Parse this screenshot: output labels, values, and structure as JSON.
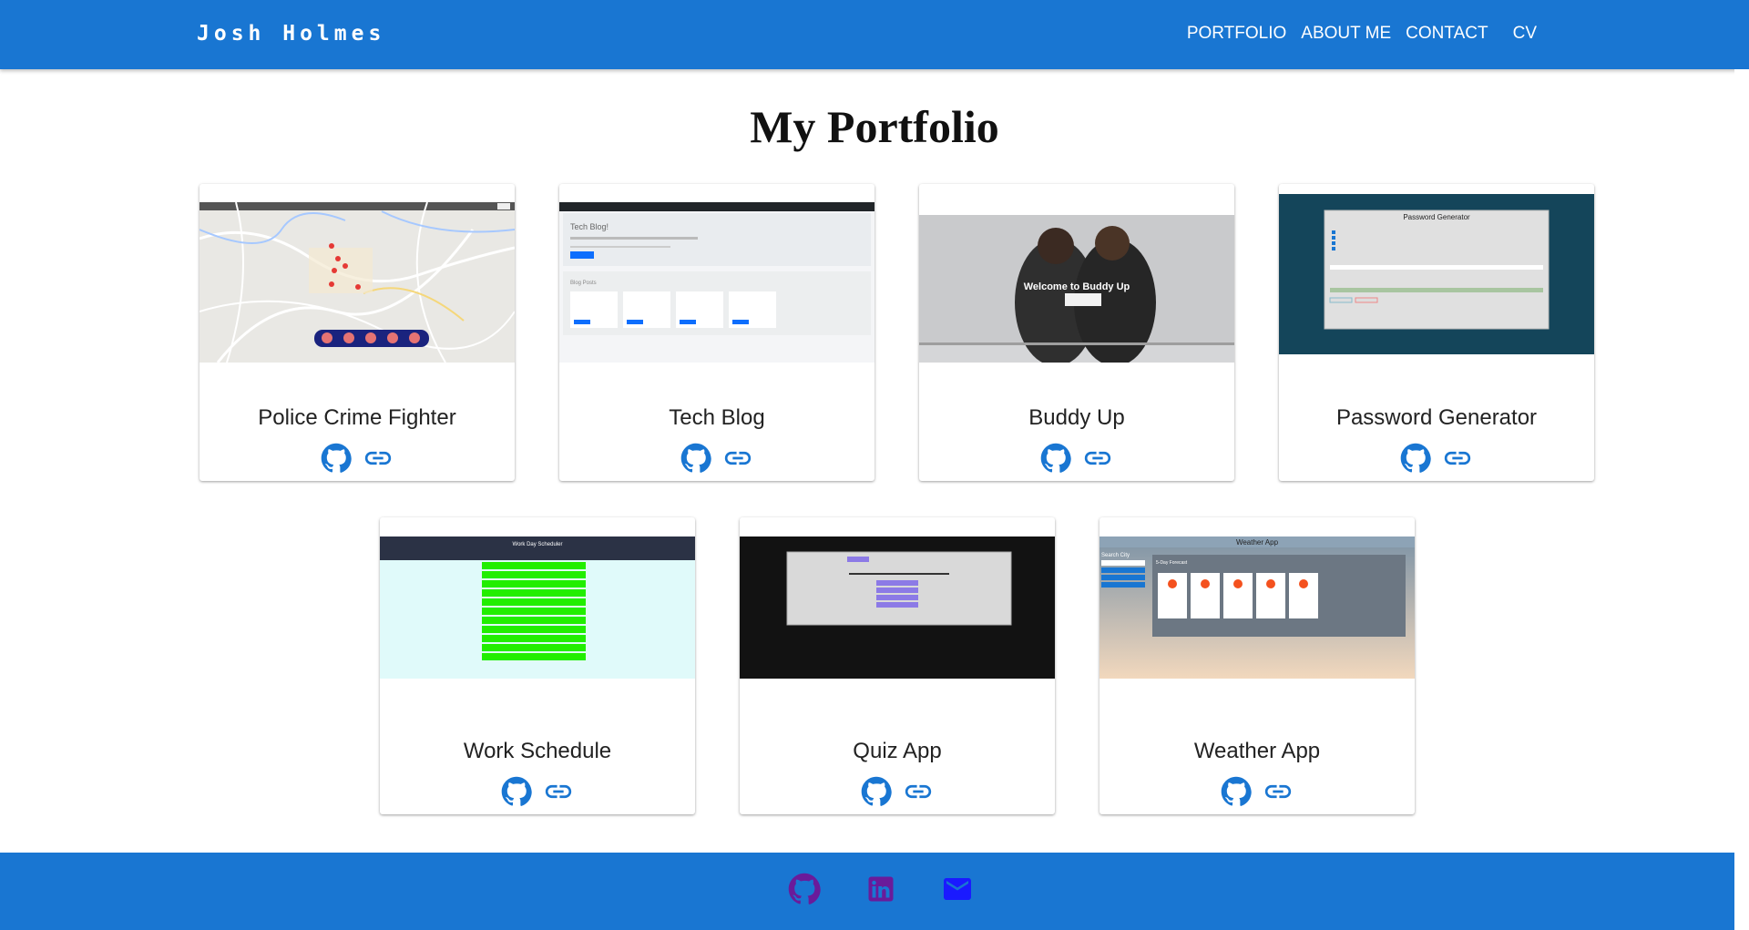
{
  "header": {
    "brand": "Josh Holmes",
    "nav": [
      {
        "label": "PORTFOLIO"
      },
      {
        "label": "ABOUT ME"
      },
      {
        "label": "CONTACT"
      },
      {
        "label": "CV"
      }
    ]
  },
  "main": {
    "title": "My Portfolio",
    "projects": [
      {
        "title": "Police Crime Fighter",
        "github_icon": "github-icon",
        "link_icon": "link-icon"
      },
      {
        "title": "Tech Blog",
        "github_icon": "github-icon",
        "link_icon": "link-icon"
      },
      {
        "title": "Buddy Up",
        "github_icon": "github-icon",
        "link_icon": "link-icon"
      },
      {
        "title": "Password Generator",
        "github_icon": "github-icon",
        "link_icon": "link-icon"
      },
      {
        "title": "Work Schedule",
        "github_icon": "github-icon",
        "link_icon": "link-icon"
      },
      {
        "title": "Quiz App",
        "github_icon": "github-icon",
        "link_icon": "link-icon"
      },
      {
        "title": "Weather App",
        "github_icon": "github-icon",
        "link_icon": "link-icon"
      }
    ],
    "thumb_text": {
      "tech_blog_heading": "Tech Blog!",
      "tech_blog_posts": "Blog Posts",
      "buddy_welcome": "Welcome to Buddy Up",
      "password_heading": "Password Generator",
      "work_heading": "Work Day Scheduler",
      "weather_heading": "Weather App",
      "weather_search": "Search City",
      "weather_forecast": "5-Day Forecast"
    }
  },
  "footer": {
    "icons": [
      "github-icon",
      "linkedin-icon",
      "email-icon"
    ]
  },
  "colors": {
    "primary": "#1976d2",
    "icon_blue": "#1976d2",
    "footer_icon_purple": "#6a1b9a",
    "footer_icon_blue": "#1a1aff"
  }
}
